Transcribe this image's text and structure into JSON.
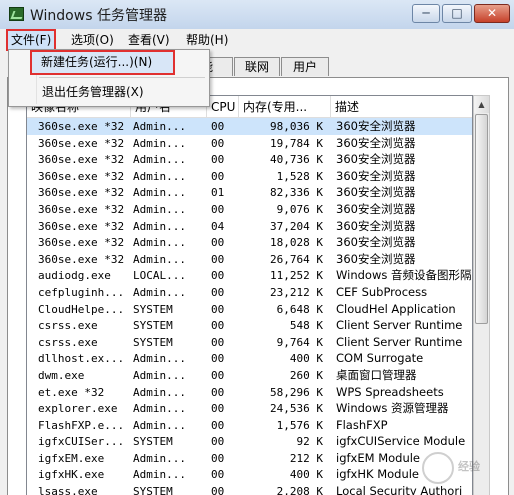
{
  "window": {
    "title": "Windows 任务管理器"
  },
  "controls": {
    "minimize": "─",
    "maximize": "□",
    "close": "✕"
  },
  "menubar": {
    "file": "文件(F)",
    "options": "选项(O)",
    "view": "查看(V)",
    "help": "帮助(H)"
  },
  "file_menu": {
    "new_task": "新建任务(运行...)(N)",
    "exit": "退出任务管理器(X)"
  },
  "tabs": {
    "perf_partial": "能",
    "network": "联网",
    "users": "用户"
  },
  "columns": {
    "name": "映像名称",
    "user": "用户名",
    "cpu": "CPU",
    "memory": "内存(专用...",
    "description": "描述"
  },
  "processes": [
    {
      "name": "360se.exe *32",
      "user": "Admin...",
      "cpu": "00",
      "mem": "98,036 K",
      "desc": "360安全浏览器"
    },
    {
      "name": "360se.exe *32",
      "user": "Admin...",
      "cpu": "00",
      "mem": "19,784 K",
      "desc": "360安全浏览器"
    },
    {
      "name": "360se.exe *32",
      "user": "Admin...",
      "cpu": "00",
      "mem": "40,736 K",
      "desc": "360安全浏览器"
    },
    {
      "name": "360se.exe *32",
      "user": "Admin...",
      "cpu": "00",
      "mem": "1,528 K",
      "desc": "360安全浏览器"
    },
    {
      "name": "360se.exe *32",
      "user": "Admin...",
      "cpu": "01",
      "mem": "82,336 K",
      "desc": "360安全浏览器"
    },
    {
      "name": "360se.exe *32",
      "user": "Admin...",
      "cpu": "00",
      "mem": "9,076 K",
      "desc": "360安全浏览器"
    },
    {
      "name": "360se.exe *32",
      "user": "Admin...",
      "cpu": "04",
      "mem": "37,204 K",
      "desc": "360安全浏览器"
    },
    {
      "name": "360se.exe *32",
      "user": "Admin...",
      "cpu": "00",
      "mem": "18,028 K",
      "desc": "360安全浏览器"
    },
    {
      "name": "360se.exe *32",
      "user": "Admin...",
      "cpu": "00",
      "mem": "26,764 K",
      "desc": "360安全浏览器"
    },
    {
      "name": "audiodg.exe",
      "user": "LOCAL...",
      "cpu": "00",
      "mem": "11,252 K",
      "desc": "Windows 音频设备图形隔"
    },
    {
      "name": "cefpluginh...",
      "user": "Admin...",
      "cpu": "00",
      "mem": "23,212 K",
      "desc": "CEF SubProcess"
    },
    {
      "name": "CloudHelpe...",
      "user": "SYSTEM",
      "cpu": "00",
      "mem": "6,648 K",
      "desc": "CloudHel Application"
    },
    {
      "name": "csrss.exe",
      "user": "SYSTEM",
      "cpu": "00",
      "mem": "548 K",
      "desc": "Client Server Runtime"
    },
    {
      "name": "csrss.exe",
      "user": "SYSTEM",
      "cpu": "00",
      "mem": "9,764 K",
      "desc": "Client Server Runtime"
    },
    {
      "name": "dllhost.ex...",
      "user": "Admin...",
      "cpu": "00",
      "mem": "400 K",
      "desc": "COM Surrogate"
    },
    {
      "name": "dwm.exe",
      "user": "Admin...",
      "cpu": "00",
      "mem": "260 K",
      "desc": "桌面窗口管理器"
    },
    {
      "name": "et.exe *32",
      "user": "Admin...",
      "cpu": "00",
      "mem": "58,296 K",
      "desc": "WPS Spreadsheets"
    },
    {
      "name": "explorer.exe",
      "user": "Admin...",
      "cpu": "00",
      "mem": "24,536 K",
      "desc": "Windows 资源管理器"
    },
    {
      "name": "FlashFXP.e...",
      "user": "Admin...",
      "cpu": "00",
      "mem": "1,576 K",
      "desc": "FlashFXP"
    },
    {
      "name": "igfxCUISer...",
      "user": "SYSTEM",
      "cpu": "00",
      "mem": "92 K",
      "desc": "igfxCUIService Module"
    },
    {
      "name": "igfxEM.exe",
      "user": "Admin...",
      "cpu": "00",
      "mem": "212 K",
      "desc": "igfxEM Module"
    },
    {
      "name": "igfxHK.exe",
      "user": "Admin...",
      "cpu": "00",
      "mem": "400 K",
      "desc": "igfxHK Module"
    },
    {
      "name": "lsass.exe",
      "user": "SYSTEM",
      "cpu": "00",
      "mem": "2,208 K",
      "desc": "Local Security Authori"
    }
  ],
  "selected_row": 0,
  "watermark": "经验"
}
